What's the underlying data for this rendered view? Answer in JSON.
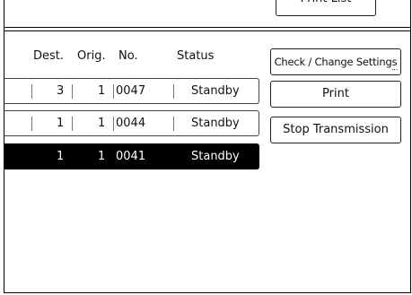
{
  "header": {
    "print_list_label": "Print List"
  },
  "table": {
    "columns": {
      "dest": "Dest.",
      "orig": "Orig.",
      "no": "No.",
      "status": "Status"
    },
    "rows": [
      {
        "dest": "3",
        "orig": "1",
        "no": "0047",
        "status": "Standby",
        "selected": false
      },
      {
        "dest": "1",
        "orig": "1",
        "no": "0044",
        "status": "Standby",
        "selected": false
      },
      {
        "dest": "1",
        "orig": "1",
        "no": "0041",
        "status": "Standby",
        "selected": true
      }
    ]
  },
  "actions": {
    "check_change_label": "Check / Change Settings",
    "more_indicator": "...",
    "print_label": "Print",
    "stop_label": "Stop Transmission"
  },
  "colors": {
    "selected_row_bg": "#000000",
    "selected_row_text": "#ffffff"
  }
}
